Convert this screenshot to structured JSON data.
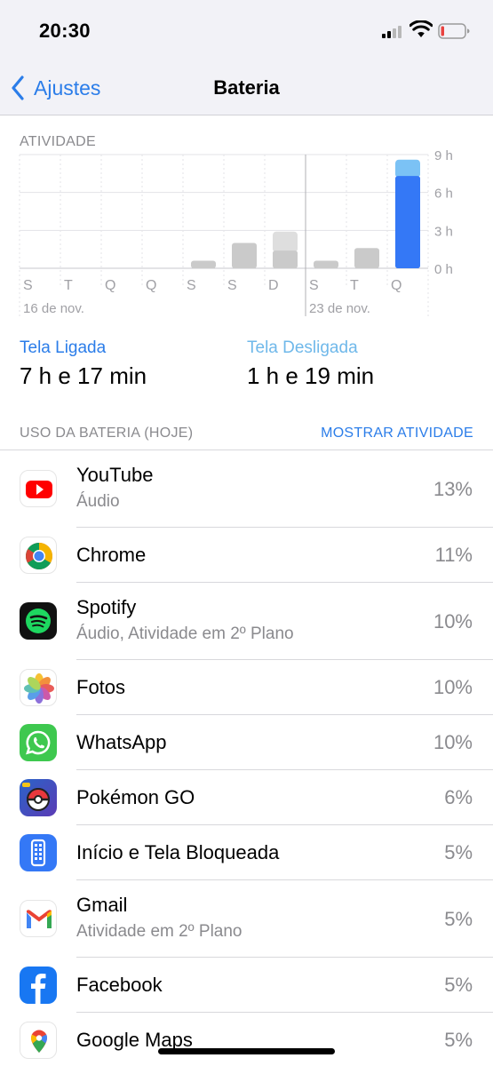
{
  "status_bar": {
    "time": "20:30"
  },
  "nav": {
    "back_label": "Ajustes",
    "title": "Bateria"
  },
  "activity": {
    "label": "ATIVIDADE",
    "chart_data": {
      "type": "bar",
      "categories": [
        "S",
        "T",
        "Q",
        "Q",
        "S",
        "S",
        "D",
        "S",
        "T",
        "Q"
      ],
      "date_labels": [
        "16 de nov.",
        "23 de nov."
      ],
      "series": [
        {
          "name": "Tela Ligada",
          "values": [
            0,
            0,
            0,
            0,
            0.6,
            2.0,
            1.4,
            0.6,
            1.6,
            7.3
          ]
        },
        {
          "name": "Tela Desligada",
          "values": [
            0,
            0,
            0,
            0,
            0,
            0,
            1.5,
            0,
            0,
            1.3
          ]
        }
      ],
      "y_ticks": [
        "0 h",
        "3 h",
        "6 h",
        "9 h"
      ],
      "ylim": [
        0,
        9
      ],
      "colors": {
        "on": "#3478f6",
        "off": "#7bc2f5",
        "past": "#cacaca",
        "past_light": "#dedede"
      }
    }
  },
  "screen": {
    "on_label": "Tela Ligada",
    "on_value": "7 h e 17 min",
    "off_label": "Tela Desligada",
    "off_value": "1 h e 19 min"
  },
  "usage": {
    "header": "USO DA BATERIA (HOJE)",
    "action": "MOSTRAR ATIVIDADE",
    "apps": [
      {
        "name": "YouTube",
        "sub": "Áudio",
        "pct": "13%",
        "icon": "youtube-icon"
      },
      {
        "name": "Chrome",
        "sub": "",
        "pct": "11%",
        "icon": "chrome-icon"
      },
      {
        "name": "Spotify",
        "sub": "Áudio, Atividade em 2º Plano",
        "pct": "10%",
        "icon": "spotify-icon"
      },
      {
        "name": "Fotos",
        "sub": "",
        "pct": "10%",
        "icon": "photos-icon"
      },
      {
        "name": "WhatsApp",
        "sub": "",
        "pct": "10%",
        "icon": "whatsapp-icon"
      },
      {
        "name": "Pokémon GO",
        "sub": "",
        "pct": "6%",
        "icon": "pokemon-go-icon"
      },
      {
        "name": "Início e Tela Bloqueada",
        "sub": "",
        "pct": "5%",
        "icon": "home-lock-screen-icon"
      },
      {
        "name": "Gmail",
        "sub": "Atividade em 2º Plano",
        "pct": "5%",
        "icon": "gmail-icon"
      },
      {
        "name": "Facebook",
        "sub": "",
        "pct": "5%",
        "icon": "facebook-icon"
      },
      {
        "name": "Google Maps",
        "sub": "",
        "pct": "5%",
        "icon": "google-maps-icon"
      }
    ]
  }
}
